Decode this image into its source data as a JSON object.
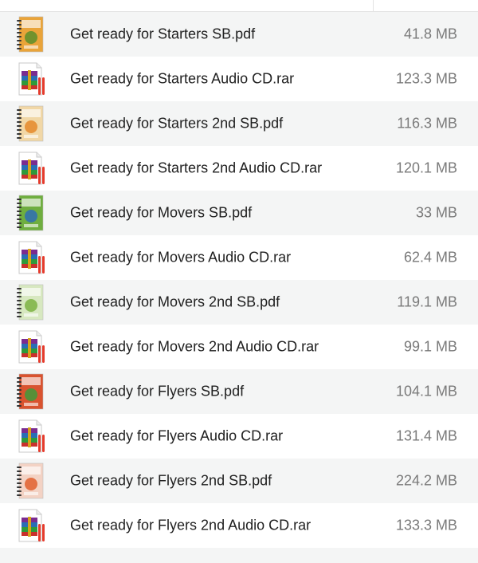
{
  "files": [
    {
      "name": "Get ready for Starters SB.pdf",
      "size": "41.8 MB",
      "icon": "book-cover-icon",
      "cover": "#e9a43a",
      "accent": "#5a8f2c"
    },
    {
      "name": "Get ready for Starters Audio CD.rar",
      "size": "123.3 MB",
      "icon": "rar-archive-icon"
    },
    {
      "name": "Get ready for Starters 2nd SB.pdf",
      "size": "116.3 MB",
      "icon": "book-cover-icon",
      "cover": "#f1d7a6",
      "accent": "#e58a2a"
    },
    {
      "name": "Get ready for Starters 2nd Audio CD.rar",
      "size": "120.1 MB",
      "icon": "rar-archive-icon"
    },
    {
      "name": "Get ready for Movers SB.pdf",
      "size": "33 MB",
      "icon": "book-cover-icon",
      "cover": "#6fae3f",
      "accent": "#2f6fb5"
    },
    {
      "name": "Get ready for Movers Audio CD.rar",
      "size": "62.4 MB",
      "icon": "rar-archive-icon"
    },
    {
      "name": "Get ready for Movers 2nd SB.pdf",
      "size": "119.1 MB",
      "icon": "book-cover-icon",
      "cover": "#d7e8c0",
      "accent": "#7cb342"
    },
    {
      "name": "Get ready for Movers 2nd Audio CD.rar",
      "size": "99.1 MB",
      "icon": "rar-archive-icon"
    },
    {
      "name": "Get ready for Flyers SB.pdf",
      "size": "104.1 MB",
      "icon": "book-cover-icon",
      "cover": "#d9532f",
      "accent": "#3f9a3a"
    },
    {
      "name": "Get ready for Flyers Audio CD.rar",
      "size": "131.4 MB",
      "icon": "rar-archive-icon"
    },
    {
      "name": "Get ready for Flyers 2nd SB.pdf",
      "size": "224.2 MB",
      "icon": "book-cover-icon",
      "cover": "#f3d2c4",
      "accent": "#e0602f"
    },
    {
      "name": "Get ready for Flyers 2nd Audio CD.rar",
      "size": "133.3 MB",
      "icon": "rar-archive-icon"
    }
  ]
}
